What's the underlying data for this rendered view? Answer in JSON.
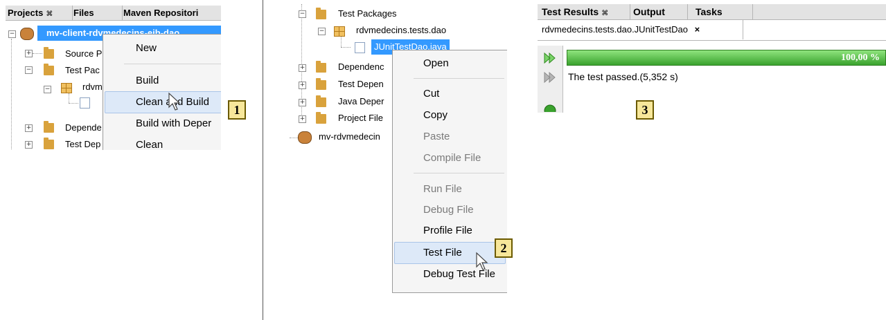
{
  "panel1": {
    "tabs": [
      {
        "label": "Projects",
        "close": "⌘"
      },
      {
        "label": "Files"
      },
      {
        "label": "Maven Repositori"
      }
    ],
    "project_name": "mv-client-rdvmedecins-ejb-dao",
    "tree": [
      "Source P",
      "Test Pac",
      "rdvm",
      "Depende",
      "Test Dep"
    ],
    "menu": [
      "New",
      "Build",
      "Clean and Build",
      "Build with Deper",
      "Clean"
    ],
    "callout": "1"
  },
  "panel2": {
    "tree": {
      "test_packages": "Test Packages",
      "package": "rdvmedecins.tests.dao",
      "file": "JUnitTestDao.java",
      "dependencies": "Dependenc",
      "test_dependencies": "Test Depen",
      "java_dependencies": "Java Deper",
      "project_files": "Project File",
      "other_project": "mv-rdvmedecin"
    },
    "menu": [
      {
        "label": "Open",
        "disabled": false
      },
      {
        "label": "Cut",
        "disabled": false
      },
      {
        "label": "Copy",
        "disabled": false
      },
      {
        "label": "Paste",
        "disabled": true
      },
      {
        "label": "Compile File",
        "disabled": true
      },
      {
        "label": "Run File",
        "disabled": true
      },
      {
        "label": "Debug File",
        "disabled": true
      },
      {
        "label": "Profile File",
        "disabled": false
      },
      {
        "label": "Test File",
        "disabled": false
      },
      {
        "label": "Debug Test File",
        "disabled": false
      }
    ],
    "callout": "2"
  },
  "panel3": {
    "tabs": [
      {
        "label": "Test Results",
        "close": "⌘"
      },
      {
        "label": "Output"
      },
      {
        "label": "Tasks"
      }
    ],
    "subtab": "rdvmedecins.tests.dao.JUnitTestDao",
    "subtab_close": "×",
    "progress_label": "100,00 %",
    "progress": 1.0,
    "result": "The test passed.(5,352 s)",
    "callout": "3"
  },
  "colors": {
    "selection": "#3399ff",
    "highlight": "#dde9f8",
    "progress": "#48b23a",
    "callout_bg": "#f7e79a"
  }
}
